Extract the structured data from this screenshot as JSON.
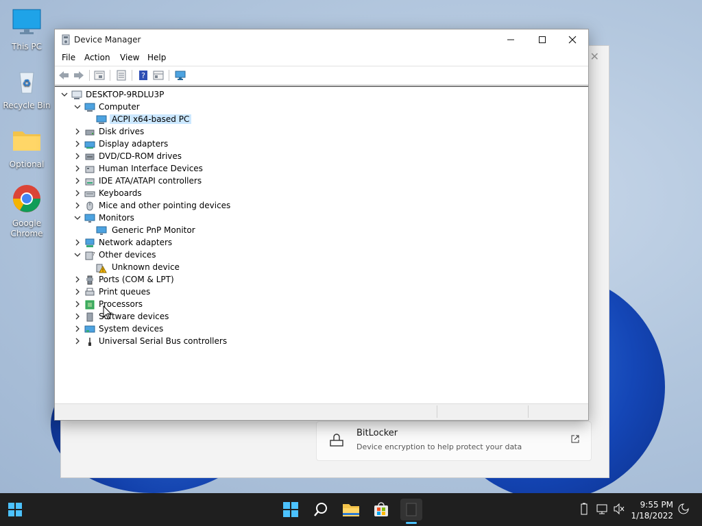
{
  "desktop": {
    "icons": [
      {
        "label": "This PC"
      },
      {
        "label": "Recycle Bin"
      },
      {
        "label": "Optional"
      },
      {
        "label": "Google Chrome"
      }
    ]
  },
  "settings_behind": {
    "bitlocker_title": "BitLocker",
    "bitlocker_desc": "Device encryption to help protect your data"
  },
  "window": {
    "title": "Device Manager",
    "menu": [
      "File",
      "Action",
      "View",
      "Help"
    ],
    "toolbar_icons": [
      "back-icon",
      "forward-icon",
      "properties-icon",
      "update-driver-icon",
      "help-icon",
      "show-hidden-icon",
      "scan-hardware-icon"
    ]
  },
  "tree": {
    "root": "DESKTOP-9RDLU3P",
    "nodes": [
      {
        "label": "Computer",
        "expanded": true,
        "icon": "computer-icon"
      },
      {
        "label": "ACPI x64-based PC",
        "child": true,
        "selected": true,
        "icon": "computer-icon"
      },
      {
        "label": "Disk drives",
        "icon": "disk-icon"
      },
      {
        "label": "Display adapters",
        "icon": "display-adapter-icon"
      },
      {
        "label": "DVD/CD-ROM drives",
        "icon": "dvd-icon"
      },
      {
        "label": "Human Interface Devices",
        "icon": "hid-icon"
      },
      {
        "label": "IDE ATA/ATAPI controllers",
        "icon": "ide-icon"
      },
      {
        "label": "Keyboards",
        "icon": "keyboard-icon"
      },
      {
        "label": "Mice and other pointing devices",
        "icon": "mouse-icon"
      },
      {
        "label": "Monitors",
        "expanded": true,
        "icon": "monitor-icon"
      },
      {
        "label": "Generic PnP Monitor",
        "child": true,
        "icon": "monitor-icon"
      },
      {
        "label": "Network adapters",
        "icon": "network-icon"
      },
      {
        "label": "Other devices",
        "expanded": true,
        "icon": "other-devices-icon"
      },
      {
        "label": "Unknown device",
        "child": true,
        "icon": "warning-device-icon"
      },
      {
        "label": "Ports (COM & LPT)",
        "icon": "port-icon"
      },
      {
        "label": "Print queues",
        "icon": "printer-icon"
      },
      {
        "label": "Processors",
        "icon": "processor-icon"
      },
      {
        "label": "Software devices",
        "icon": "software-device-icon"
      },
      {
        "label": "System devices",
        "icon": "system-device-icon"
      },
      {
        "label": "Universal Serial Bus controllers",
        "icon": "usb-icon"
      }
    ]
  },
  "taskbar": {
    "time": "9:55 PM",
    "date": "1/18/2022",
    "apps": [
      "start-icon",
      "search-icon",
      "file-explorer-icon",
      "store-icon",
      "device-manager-app-icon"
    ]
  }
}
